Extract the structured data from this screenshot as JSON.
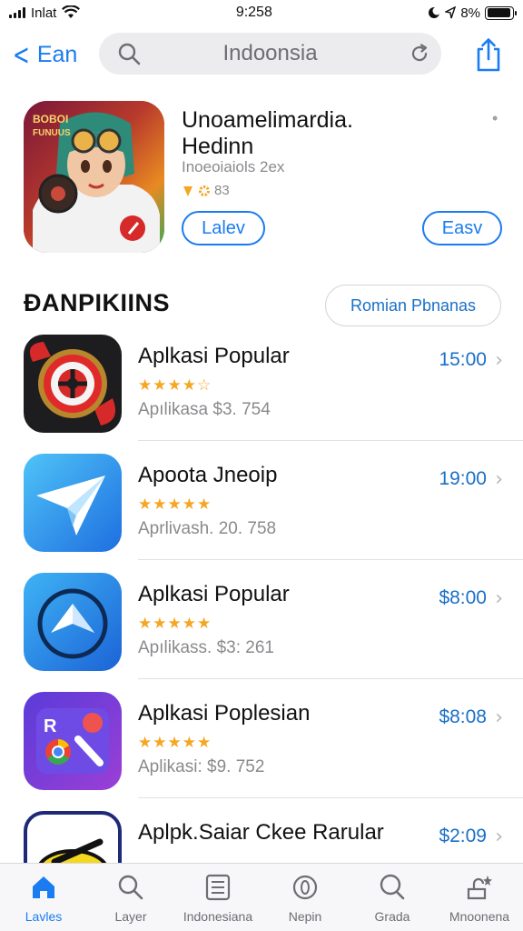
{
  "status_bar": {
    "carrier": "Inlat",
    "time": "9:258",
    "battery_text": "8%",
    "battery_level": 0.95
  },
  "nav": {
    "back_label": "Ean",
    "search_text": "Indoonsia"
  },
  "featured": {
    "title_line1": "Unoamelimardia.",
    "title_line2": "Hedinn",
    "subtitle": "Inoeoiaiols 2ex",
    "rating_text": "83",
    "more_mark": "•",
    "icon_text_line1": "BOBOI",
    "icon_text_line2": "FUNUUS",
    "button_left": "Lalev",
    "button_right": "Easv"
  },
  "section": {
    "title": "ÐANPIKIINS",
    "button_label": "Romian Pbnanas"
  },
  "apps": [
    {
      "name": "Aplkasi  Popular",
      "stars": "★★★★☆",
      "rating": 4,
      "meta": "Apılikasa   $3. 754",
      "price": "15:00",
      "icon": "red-target-icon"
    },
    {
      "name": "Apoota Jneoip",
      "stars": "★★★★★",
      "rating": 5,
      "meta": "Aprlivash.   20. 758",
      "price": "19:00",
      "icon": "paper-plane-icon"
    },
    {
      "name": "Aplkasi  Popular",
      "stars": "★★★★★",
      "rating": 4.5,
      "meta": "Apılikass.   $3: 261",
      "price": "$8:00",
      "icon": "compass-plane-icon"
    },
    {
      "name": "Aplkasi  Poplesian",
      "stars": "★★★★★",
      "rating": 4.5,
      "meta": "Aplikasi:   $9. 752",
      "price": "$8:08",
      "icon": "chrome-tools-icon"
    },
    {
      "name": "Aplpk.Saiar Ckee Rarular",
      "stars": "",
      "rating": null,
      "meta": "",
      "price": "$2:09",
      "icon": "yellow-disc-icon"
    }
  ],
  "tabs": [
    {
      "label": "Lavles",
      "icon": "home-icon",
      "active": true
    },
    {
      "label": "Layer",
      "icon": "search-icon",
      "active": false
    },
    {
      "label": "Indonesiana",
      "icon": "list-icon",
      "active": false
    },
    {
      "label": "Nepin",
      "icon": "compass-icon",
      "active": false
    },
    {
      "label": "Grada",
      "icon": "magnifier-icon",
      "active": false
    },
    {
      "label": "Mnoonena",
      "icon": "updates-icon",
      "active": false
    }
  ],
  "colors": {
    "accent": "#1a7cf0",
    "price": "#1a6fc8",
    "star": "#f5a623"
  }
}
